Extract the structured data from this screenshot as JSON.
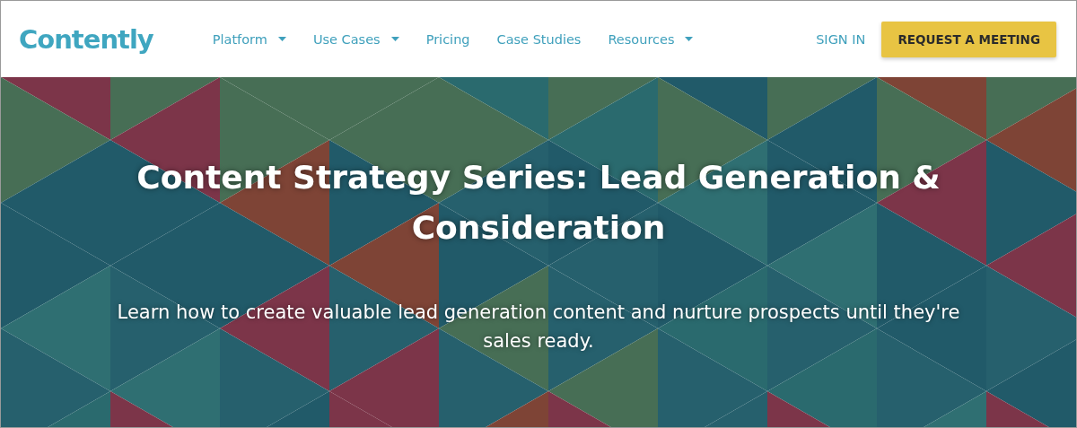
{
  "header": {
    "logo": "Contently",
    "nav": [
      {
        "label": "Platform",
        "dropdown": true
      },
      {
        "label": "Use Cases",
        "dropdown": true
      },
      {
        "label": "Pricing",
        "dropdown": false
      },
      {
        "label": "Case Studies",
        "dropdown": false
      },
      {
        "label": "Resources",
        "dropdown": true
      }
    ],
    "sign_in": "SIGN IN",
    "cta": "REQUEST A MEETING"
  },
  "hero": {
    "title": "Content Strategy Series: Lead Generation & Consideration",
    "subtitle": "Learn how to create valuable lead generation content and nurture prospects until they're sales ready."
  }
}
